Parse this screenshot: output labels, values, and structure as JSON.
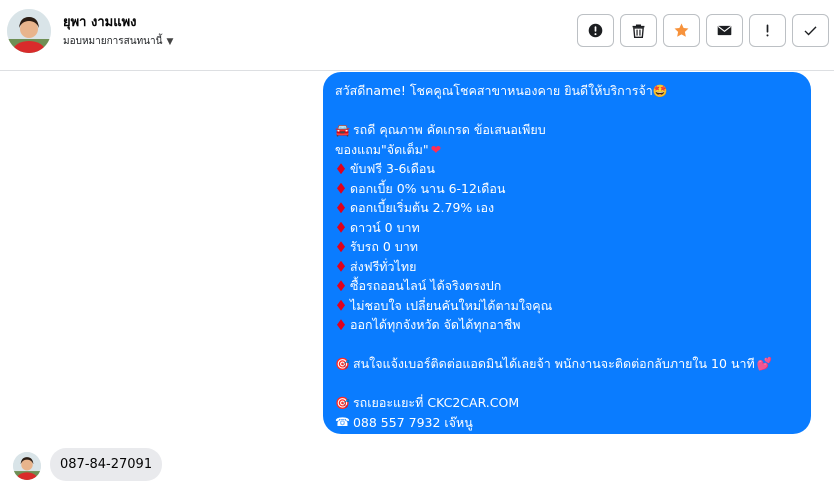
{
  "header": {
    "contact_name": "ยุพา งามแพง",
    "assign_label": "มอบหมายการสนทนานี้",
    "actions": [
      {
        "name": "alert-circle-icon",
        "label": "Mark as spam"
      },
      {
        "name": "trash-icon",
        "label": "Delete"
      },
      {
        "name": "star-icon",
        "label": "Follow up",
        "color": "#f7923b"
      },
      {
        "name": "envelope-icon",
        "label": "Mark as unread"
      },
      {
        "name": "exclamation-icon",
        "label": "Important"
      },
      {
        "name": "check-icon",
        "label": "Done"
      }
    ]
  },
  "outgoing_message": {
    "color": "#0a7cff",
    "line1": "สวัสดีname! โชคคูณโชคสาขาหนองคาย ยินดีให้บริการจ้า",
    "line2": "รถดี คุณภาพ คัดเกรด ข้อเสนอเพียบ",
    "line3": "ของแถม\"จัดเต็ม\"",
    "bullets": [
      "ขับฟรี 3-6เดือน",
      "ดอกเบี้ย 0% นาน 6-12เดือน",
      "ดอกเบี้ยเริ่มต้น 2.79% เอง",
      "ดาวน์ 0 บาท",
      "รับรถ 0 บาท",
      "ส่งฟรีทั่วไทย",
      "ซื้อรถออนไลน์ ได้จริงตรงปก",
      "ไม่ชอบใจ เปลี่ยนคันใหม่ได้ตามใจคุณ",
      "ออกได้ทุกจังหวัด จัดได้ทุกอาชีพ"
    ],
    "line_contact": "สนใจแจ้งเบอร์ติดต่อแอดมินได้เลยจ้า พนักงานจะติดต่อกลับภายใน 10 นาที",
    "line_site": "รถเยอะแยะที่ CKC2CAR.COM",
    "line_phone": "088 557 7932 เจ๊หนู"
  },
  "incoming_message": {
    "text": "087-84-27091"
  }
}
